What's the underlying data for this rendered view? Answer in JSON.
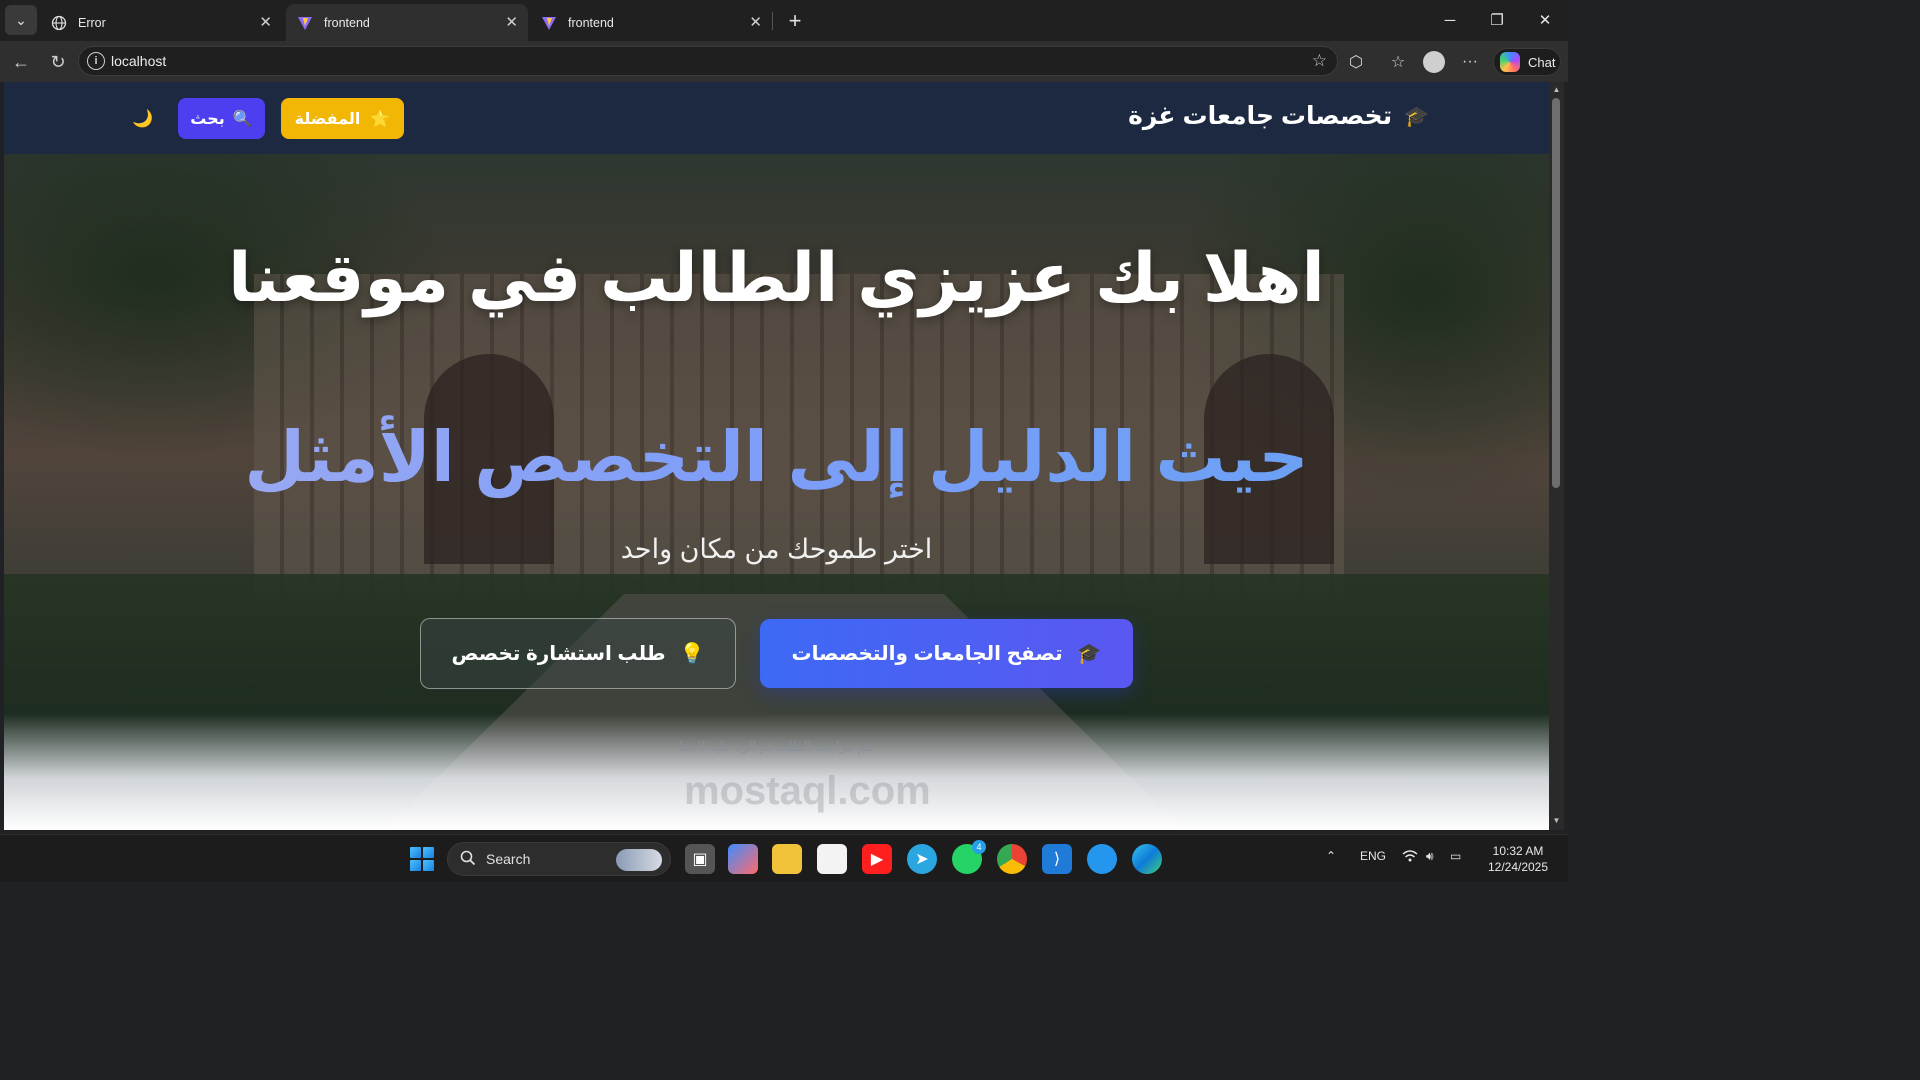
{
  "browser": {
    "tabs": [
      {
        "title": "Error",
        "icon": "globe-icon",
        "active": false
      },
      {
        "title": "frontend",
        "icon": "vite-icon",
        "active": true
      },
      {
        "title": "frontend",
        "icon": "vite-icon",
        "active": false
      }
    ],
    "url": "localhost",
    "copilot_label": "Chat"
  },
  "site": {
    "brand": "تخصصات جامعات غزة",
    "brand_icon": "🎓",
    "favorites_label": "المفضلة",
    "favorites_icon": "⭐",
    "search_label": "بحث",
    "search_icon": "🔍",
    "theme_icon": "🌙",
    "colors": {
      "header": "#1d2941",
      "favorites": "#f2b705",
      "search": "#4d3ff0",
      "accent": "#7d9cf7",
      "primary_button": "#3d6af5"
    }
  },
  "hero": {
    "title": "اهلا بك عزيزي الطالب في موقعنا",
    "accent": "حيث الدليل إلى التخصص الأمثل",
    "subtitle": "اختر طموحك من مكان واحد",
    "browse_label": "تصفح الجامعات والتخصصات",
    "browse_icon": "🎓",
    "consult_label": "طلب استشارة تخصص",
    "consult_icon": "💡",
    "note": "يتم مراجعة الطلب ثم الرد عليه لاحقا"
  },
  "watermark": "mostaql.com",
  "taskbar": {
    "search_label": "Search",
    "language": "ENG",
    "time": "10:32 AM",
    "date": "12/24/2025",
    "whatsapp_badge": "4"
  }
}
